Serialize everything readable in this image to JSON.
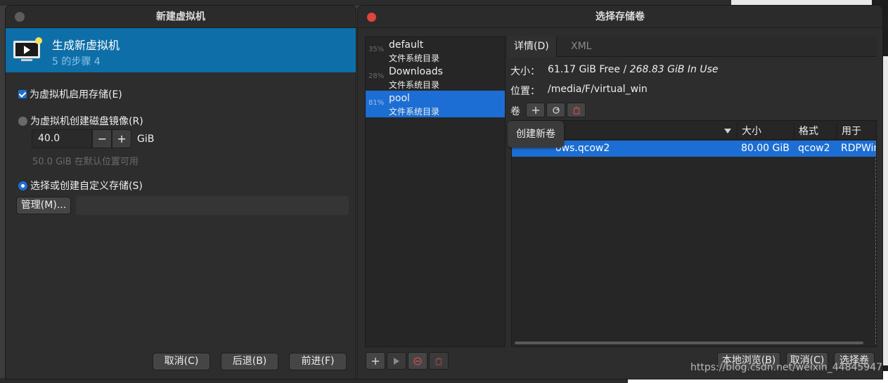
{
  "window_left": {
    "title": "新建虚拟机",
    "header_title": "生成新虚拟机",
    "header_step": "5 的步骤 4",
    "enable_storage_label": "为虚拟机启用存储(E)",
    "create_disk_label": "为虚拟机创建磁盘镜像(R)",
    "disk_size_value": "40.0",
    "spin_minus": "−",
    "spin_plus": "+",
    "disk_unit": "GiB",
    "available_note": "50.0 GiB 在默认位置可用",
    "custom_storage_label": "选择或创建自定义存储(S)",
    "manage_button": "管理(M)...",
    "cancel_button": "取消(C)",
    "back_button": "后退(B)",
    "forward_button": "前进(F)"
  },
  "window_right": {
    "title": "选择存储卷",
    "pools": [
      {
        "pct": "35%",
        "name": "default",
        "type": "文件系统目录"
      },
      {
        "pct": "28%",
        "name": "Downloads",
        "type": "文件系统目录"
      },
      {
        "pct": "81%",
        "name": "pool",
        "type": "文件系统目录"
      }
    ],
    "tabs": {
      "details": "详情(D)",
      "xml": "XML"
    },
    "size_label": "大小：",
    "size_free": "61.17 GiB Free / ",
    "size_in_use": "268.83 GiB In Use",
    "location_label": "位置：",
    "location_value": "/media/F/virtual_win",
    "volumes_label": "卷",
    "tooltip": "创建新卷",
    "columns": {
      "name": "",
      "size": "大小",
      "format": "格式",
      "used_by": "用于"
    },
    "volumes": [
      {
        "name": "ows.qcow2",
        "size": "80.00 GiB",
        "format": "qcow2",
        "used_by": "RDPWin"
      }
    ],
    "browse_local_button": "本地浏览(B)",
    "cancel_button": "取消(C)",
    "choose_volume_button": "选择卷"
  },
  "watermark": "https://blog.csdn.net/weixin_44845947",
  "colors": {
    "accent": "#1c6ed4",
    "header": "#0e6fa8",
    "close": "#e0443e"
  }
}
